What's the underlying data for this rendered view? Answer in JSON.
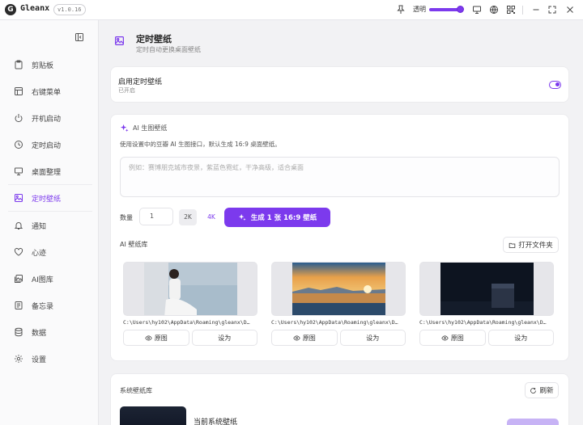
{
  "app": {
    "logo_letter": "G",
    "name": "Gleanx",
    "version": "v1.0.16"
  },
  "titlebar": {
    "opacity_label": "透明",
    "opacity_value": 90
  },
  "sidebar": {
    "items": [
      {
        "label": "剪贴板",
        "icon": "clipboard-icon"
      },
      {
        "label": "右键菜单",
        "icon": "menu-icon"
      },
      {
        "label": "开机启动",
        "icon": "power-icon"
      },
      {
        "label": "定时启动",
        "icon": "clock-icon"
      },
      {
        "label": "桌面整理",
        "icon": "monitor-icon"
      },
      {
        "label": "定时壁纸",
        "icon": "image-icon",
        "active": true
      },
      {
        "label": "通知",
        "icon": "bell-icon"
      },
      {
        "label": "心迹",
        "icon": "heart-icon"
      },
      {
        "label": "AI图库",
        "icon": "gallery-icon"
      },
      {
        "label": "备忘录",
        "icon": "note-icon"
      },
      {
        "label": "数据",
        "icon": "database-icon"
      },
      {
        "label": "设置",
        "icon": "gear-icon"
      }
    ]
  },
  "page": {
    "title": "定时壁纸",
    "subtitle": "定时自动更换桌面壁纸"
  },
  "enable_card": {
    "title": "启用定时壁纸",
    "status": "已开启",
    "enabled": true
  },
  "ai_card": {
    "title": "AI 生图壁纸",
    "description": "使用设置中的豆瓣 AI 生图接口，默认生成 16:9 桌面壁纸。",
    "prompt_placeholder": "例如：赛博朋克城市夜景，紫蓝色霓虹，干净高级，适合桌面",
    "quantity_label": "数量",
    "quantity_value": "1",
    "res_2k": "2K",
    "res_4k": "4K",
    "generate_label": "生成 1 张 16:9 壁纸",
    "library_label": "AI 壁纸库",
    "open_folder_label": "打开文件夹",
    "wallpapers": [
      {
        "path": "C:\\Users\\hy102\\AppData\\Roaming\\gleanx\\D…",
        "preview_label": "原图",
        "set_label": "设为"
      },
      {
        "path": "C:\\Users\\hy102\\AppData\\Roaming\\gleanx\\D…",
        "preview_label": "原图",
        "set_label": "设为"
      },
      {
        "path": "C:\\Users\\hy102\\AppData\\Roaming\\gleanx\\D…",
        "preview_label": "原图",
        "set_label": "设为"
      }
    ]
  },
  "system_card": {
    "title": "系统壁纸库",
    "refresh_label": "刷新",
    "current_label": "当前系统壁纸"
  },
  "colors": {
    "accent": "#7c3aed",
    "background": "#f2f2f4"
  }
}
